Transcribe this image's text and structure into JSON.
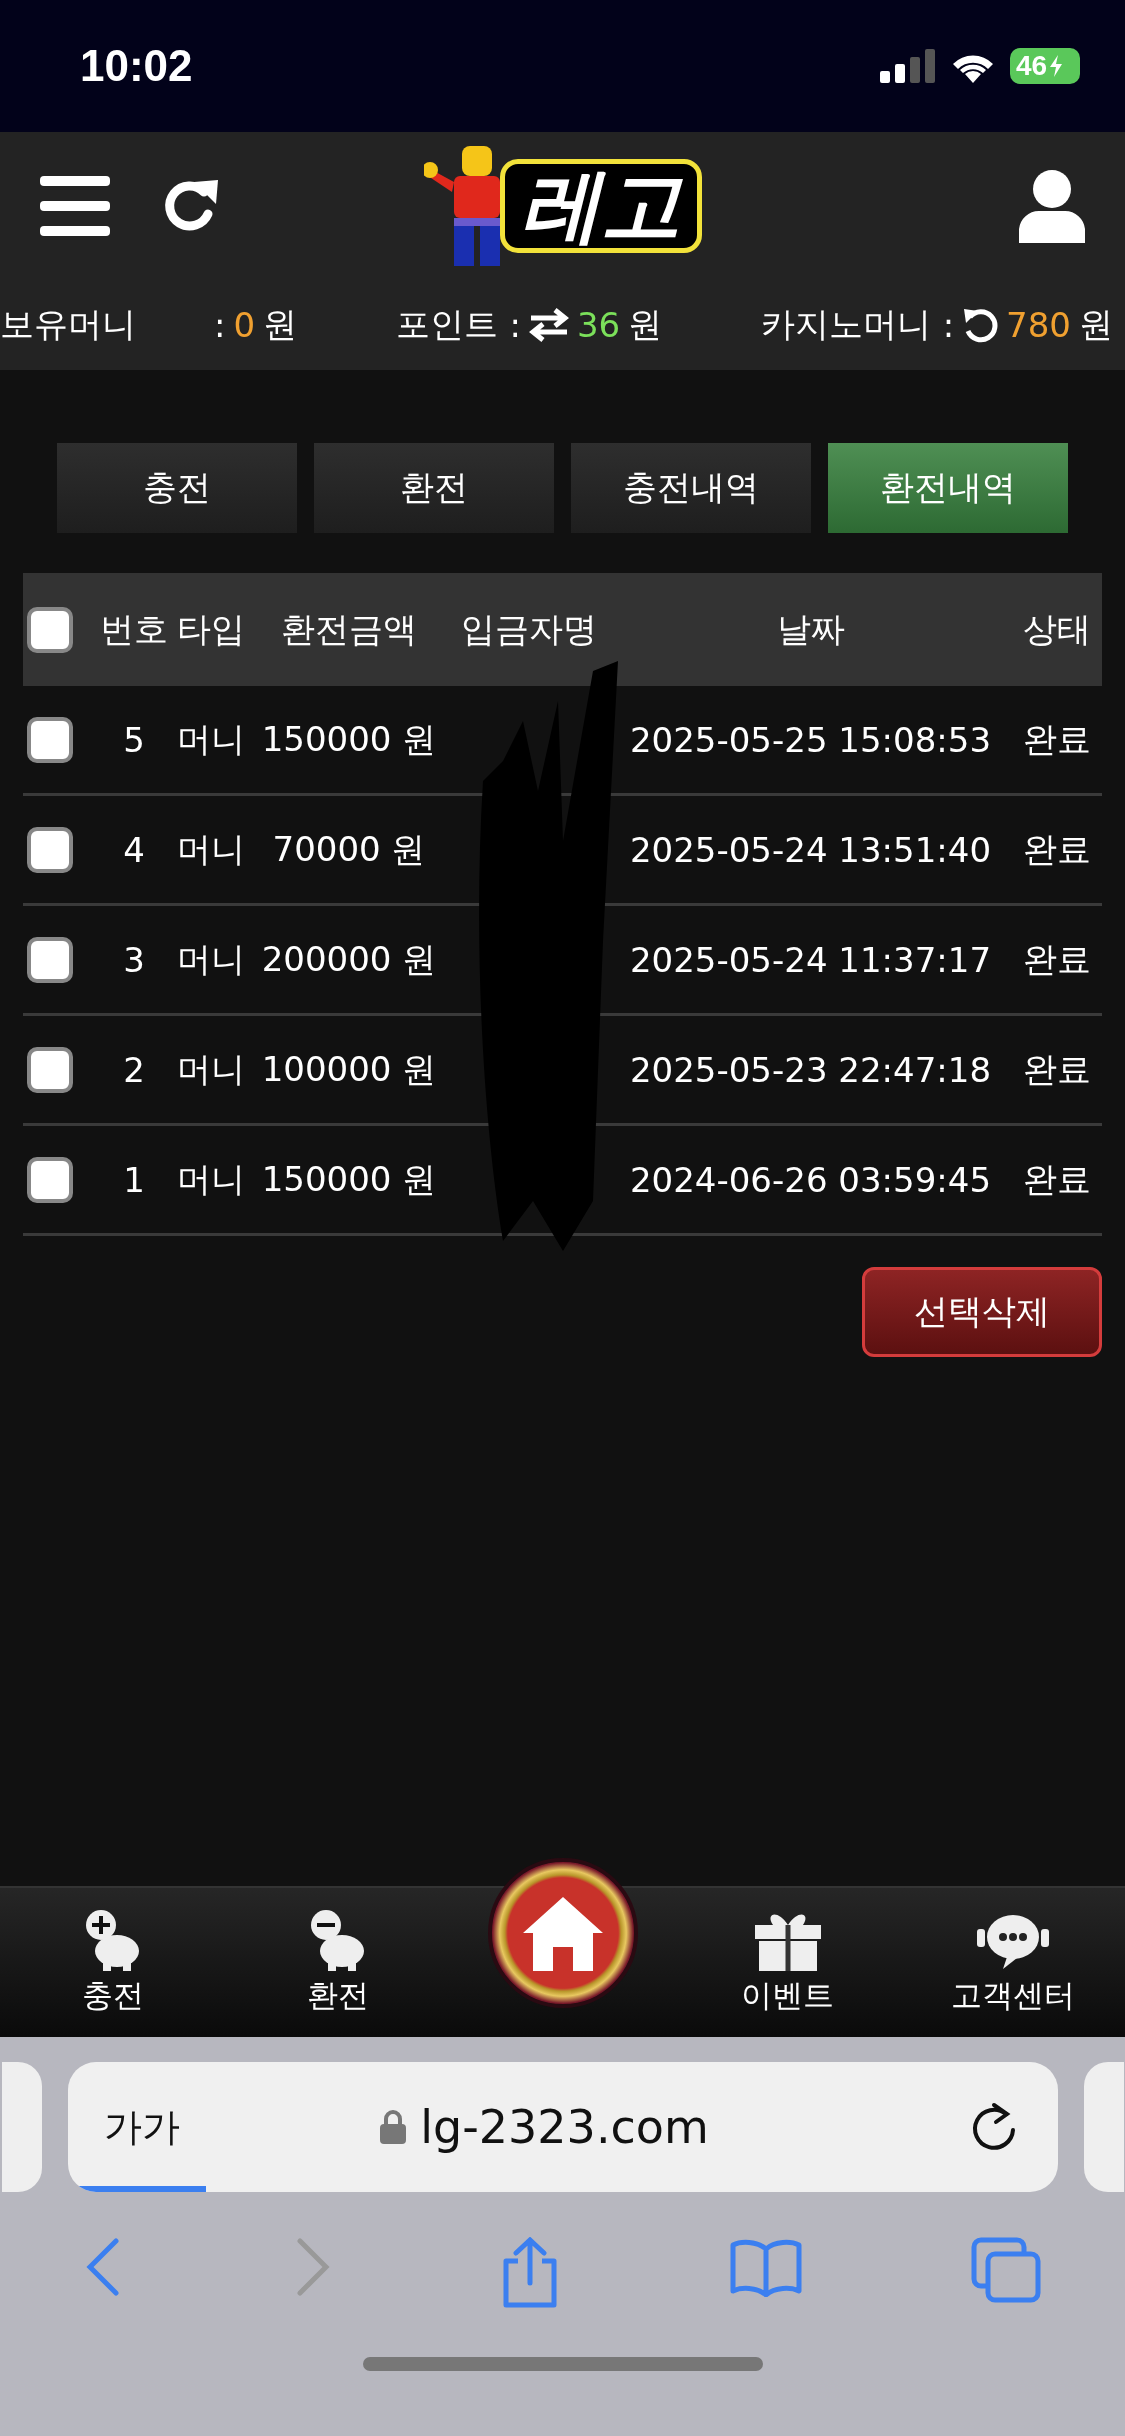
{
  "status_bar": {
    "time": "10:02",
    "battery": "46"
  },
  "header": {
    "logo_text": "레고"
  },
  "balances": [
    {
      "label": "보유머니",
      "sep": ":",
      "kind": "plain",
      "value": "0",
      "color": "#f0a030",
      "unit": "원"
    },
    {
      "label": "포인트",
      "sep": ":",
      "kind": "transfer",
      "value": "36",
      "color": "#7be05a",
      "unit": "원"
    },
    {
      "label": "카지노머니",
      "sep": ":",
      "kind": "refresh",
      "value": "780",
      "color": "#f0a030",
      "unit": "원"
    }
  ],
  "tabs": [
    {
      "label": "충전",
      "selected": false
    },
    {
      "label": "환전",
      "selected": false
    },
    {
      "label": "충전내역",
      "selected": false
    },
    {
      "label": "환전내역",
      "selected": true
    }
  ],
  "table": {
    "select_all_checked": false,
    "columns": [
      "번호",
      "타입",
      "환전금액",
      "입금자명",
      "날짜",
      "상태"
    ],
    "rows": [
      {
        "checked": false,
        "number": "5",
        "type": "머니",
        "amount": "150000 원",
        "date": "2025-05-25 15:08:53",
        "status": "완료"
      },
      {
        "checked": false,
        "number": "4",
        "type": "머니",
        "amount": "70000 원",
        "date": "2025-05-24 13:51:40",
        "status": "완료"
      },
      {
        "checked": false,
        "number": "3",
        "type": "머니",
        "amount": "200000 원",
        "date": "2025-05-24 11:37:17",
        "status": "완료"
      },
      {
        "checked": false,
        "number": "2",
        "type": "머니",
        "amount": "100000 원",
        "date": "2025-05-23 22:47:18",
        "status": "완료"
      },
      {
        "checked": false,
        "number": "1",
        "type": "머니",
        "amount": "150000 원",
        "date": "2024-06-26 03:59:45",
        "status": "완료"
      }
    ]
  },
  "delete_button": "선택삭제",
  "bottom_nav": [
    {
      "kind": "deposit",
      "label": "충전"
    },
    {
      "kind": "withdraw",
      "label": "환전"
    },
    {
      "kind": "home"
    },
    {
      "kind": "gift",
      "label": "이벤트"
    },
    {
      "kind": "support",
      "label": "고객센터"
    }
  ],
  "browser": {
    "text_size_button": "가가",
    "url": "lg-2323.com",
    "level": 0.14
  }
}
